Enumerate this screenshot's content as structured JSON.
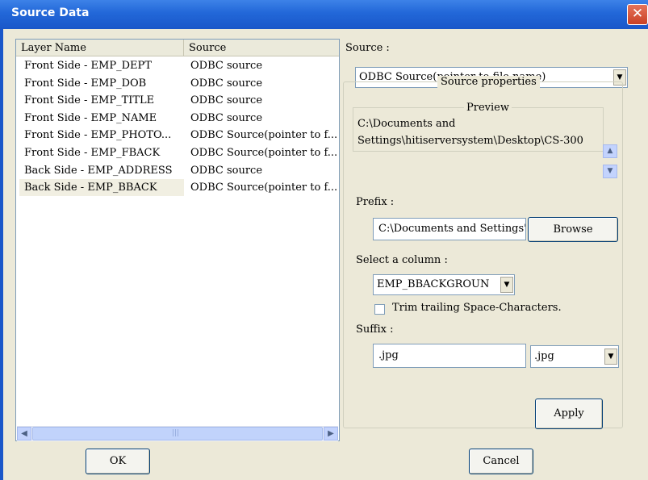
{
  "window": {
    "title": "Source Data",
    "close_glyph": "✕"
  },
  "listview": {
    "columns": [
      "Layer Name",
      "Source"
    ],
    "rows": [
      {
        "layer": "Front Side - EMP_DEPT",
        "source": "ODBC source"
      },
      {
        "layer": "Front Side - EMP_DOB",
        "source": "ODBC source"
      },
      {
        "layer": "Front Side - EMP_TITLE",
        "source": "ODBC source"
      },
      {
        "layer": "Front Side - EMP_NAME",
        "source": "ODBC source"
      },
      {
        "layer": "Front Side - EMP_PHOTO...",
        "source": "ODBC Source(pointer to f..."
      },
      {
        "layer": "Front Side - EMP_FBACK",
        "source": "ODBC Source(pointer to f..."
      },
      {
        "layer": "Back Side - EMP_ADDRESS",
        "source": "ODBC source"
      },
      {
        "layer": "Back Side - EMP_BBACK",
        "source": "ODBC Source(pointer to f..."
      }
    ],
    "selected_index": 7,
    "scroll_left_glyph": "◀",
    "scroll_right_glyph": "▶",
    "scroll_grip": "|||"
  },
  "source": {
    "label": "Source :",
    "selected": "ODBC Source(pointer to file name)",
    "arrow": "▼"
  },
  "source_properties": {
    "legend": "Source properties",
    "preview": {
      "legend": "Preview",
      "line1": "C:\\Documents and",
      "line2": "Settings\\hitiserversystem\\Desktop\\CS-300",
      "up_glyph": "▲",
      "down_glyph": "▼"
    },
    "prefix": {
      "label": "Prefix :",
      "value": "C:\\Documents and Settings'",
      "browse_label": "Browse"
    },
    "column": {
      "label": "Select a column :",
      "selected": "EMP_BBACKGROUN",
      "arrow": "▼"
    },
    "trim": {
      "label": "Trim trailing Space-Characters.",
      "checked": false
    },
    "suffix": {
      "label": "Suffix :",
      "value": ".jpg",
      "selected": ".jpg",
      "arrow": "▼"
    },
    "apply_label": "Apply"
  },
  "footer": {
    "ok_label": "OK",
    "cancel_label": "Cancel"
  }
}
